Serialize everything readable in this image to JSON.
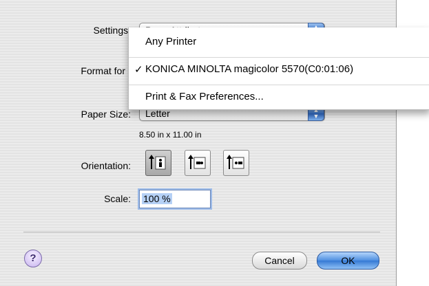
{
  "settings": {
    "label": "Settings:",
    "value": "Page Attributes"
  },
  "format_for": {
    "label": "Format for"
  },
  "menu": {
    "items": [
      "Any Printer",
      "KONICA MINOLTA magicolor 5570(C0:01:06)",
      "Print & Fax Preferences..."
    ],
    "checked_index": 1,
    "check_glyph": "✓"
  },
  "paper_size": {
    "label": "Paper Size:",
    "value": "Letter",
    "dimensions": "8.50 in x 11.00 in"
  },
  "orientation": {
    "label": "Orientation:",
    "options": [
      "portrait",
      "landscape-left",
      "landscape-right"
    ],
    "selected_index": 0
  },
  "scale": {
    "label": "Scale:",
    "value": "100 %"
  },
  "buttons": {
    "help": "?",
    "cancel": "Cancel",
    "ok": "OK"
  },
  "colors": {
    "accent": "#3579d4",
    "help_purple": "#c7b3ef"
  }
}
